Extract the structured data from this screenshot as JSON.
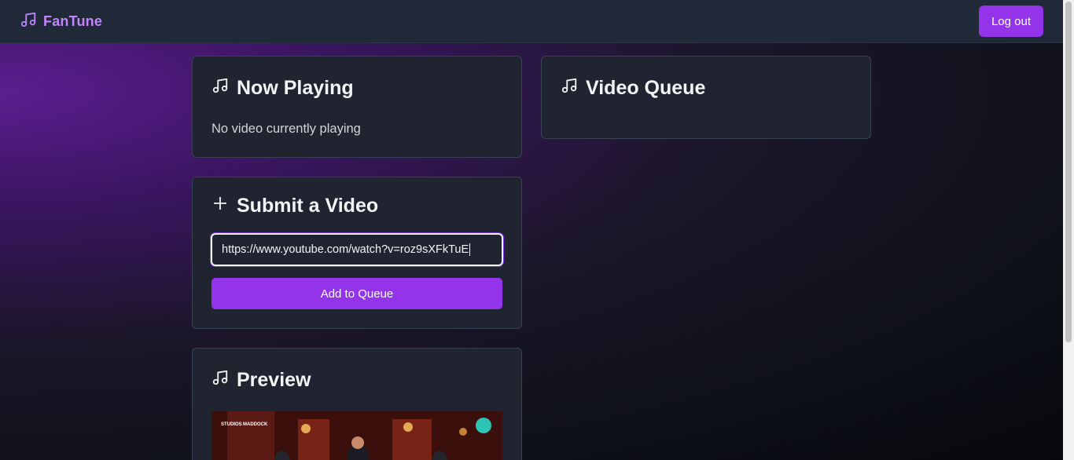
{
  "app": {
    "name": "FanTune",
    "icon": "music-note-icon"
  },
  "header": {
    "logout_label": "Log out"
  },
  "now_playing": {
    "title": "Now Playing",
    "empty_text": "No video currently playing"
  },
  "queue": {
    "title": "Video Queue"
  },
  "submit": {
    "title": "Submit a Video",
    "url_value": "https://www.youtube.com/watch?v=roz9sXFkTuE",
    "button_label": "Add to Queue"
  },
  "preview": {
    "title": "Preview",
    "thumbnail_text": [
      "STUDIOS",
      "MADDOCK"
    ]
  },
  "colors": {
    "accent": "#9333ea",
    "brand": "#c084fc",
    "card": "#1f2430",
    "navbar": "#1f2937"
  }
}
